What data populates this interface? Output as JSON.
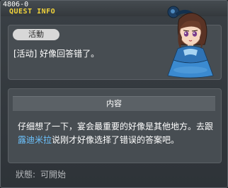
{
  "window": {
    "quest_id": "4806-0",
    "title": "QUEST INFO"
  },
  "quest": {
    "category_tag": "活動",
    "name": "[活动] 好像回答错了。"
  },
  "content": {
    "header": "内容",
    "text_before": "仔细想了一下，宴会最重要的好像是其他地方。去跟",
    "npc_name": "露迪米拉",
    "text_after": "说刚才好像选择了错误的答案吧。"
  },
  "status": {
    "label": "狀態:",
    "value": "可開始"
  },
  "colors": {
    "title": "#f2d43a",
    "npc_highlight": "#6cc3ff",
    "panel": "#474d52",
    "background": "#2e3338"
  },
  "icons": {
    "npc_portrait": "npc-portrait-rudimira"
  }
}
